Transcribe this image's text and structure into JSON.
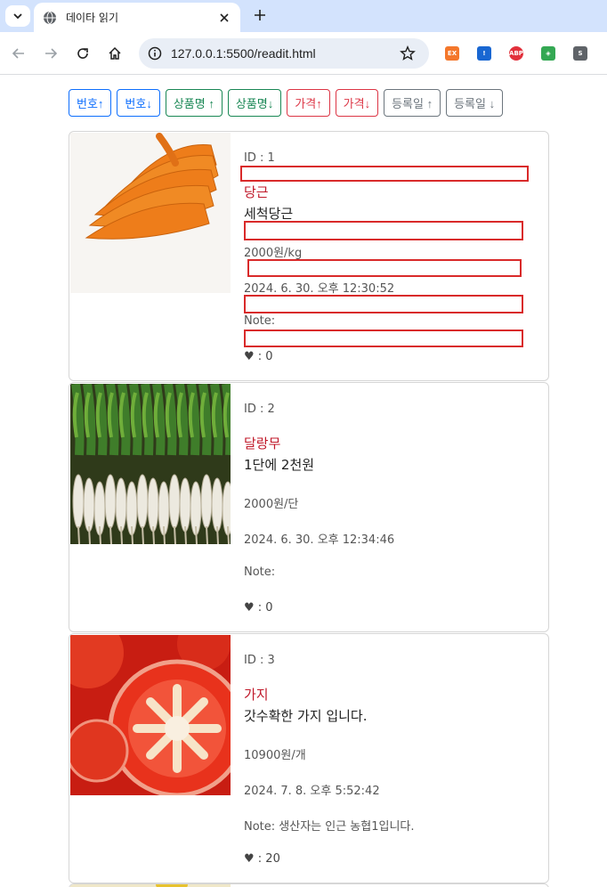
{
  "browser": {
    "tab_title": "데이타 읽기",
    "url": "127.0.0.1:5500/readit.html",
    "extensions": [
      {
        "name": "ex-extension-icon",
        "label": "EX",
        "color": "#f4772b"
      },
      {
        "name": "shield-extension-icon",
        "label": "!",
        "color": "#1967d2"
      },
      {
        "name": "adblock-plus-icon",
        "label": "ABP",
        "color": "#e2313c"
      },
      {
        "name": "colorful-extension-icon",
        "label": "◈",
        "color": "#34a853"
      },
      {
        "name": "s-extension-icon",
        "label": "S",
        "color": "#5f6368"
      }
    ]
  },
  "sort_buttons": [
    {
      "label": "번호↑",
      "variant": "blue"
    },
    {
      "label": "번호↓",
      "variant": "blue"
    },
    {
      "label": "상품명 ↑",
      "variant": "green"
    },
    {
      "label": "상품명↓",
      "variant": "green"
    },
    {
      "label": "가격↑",
      "variant": "red"
    },
    {
      "label": "가격↓",
      "variant": "red"
    },
    {
      "label": "등록일 ↑",
      "variant": "gray"
    },
    {
      "label": "등록일 ↓",
      "variant": "gray"
    }
  ],
  "products": [
    {
      "id_text": "ID : 1",
      "name": "당근",
      "description": "세척당근",
      "price": "2000원/kg",
      "date": "2024. 6. 30. 오후 12:30:52",
      "note": "Note:",
      "likes": "♥ : 0",
      "image": "carrots"
    },
    {
      "id_text": "ID : 2",
      "name": "달랑무",
      "description": "1단에 2천원",
      "price": "2000원/단",
      "date": "2024. 6. 30. 오후 12:34:46",
      "note": "Note:",
      "likes": "♥ : 0",
      "image": "radishes"
    },
    {
      "id_text": "ID : 3",
      "name": "가지",
      "description": "갓수확한 가지 입니다.",
      "price": "10900원/개",
      "date": "2024. 7. 8. 오후 5:52:42",
      "note": "Note: 생산자는 인근 농협1입니다.",
      "likes": "♥ : 20",
      "image": "tomato"
    }
  ]
}
